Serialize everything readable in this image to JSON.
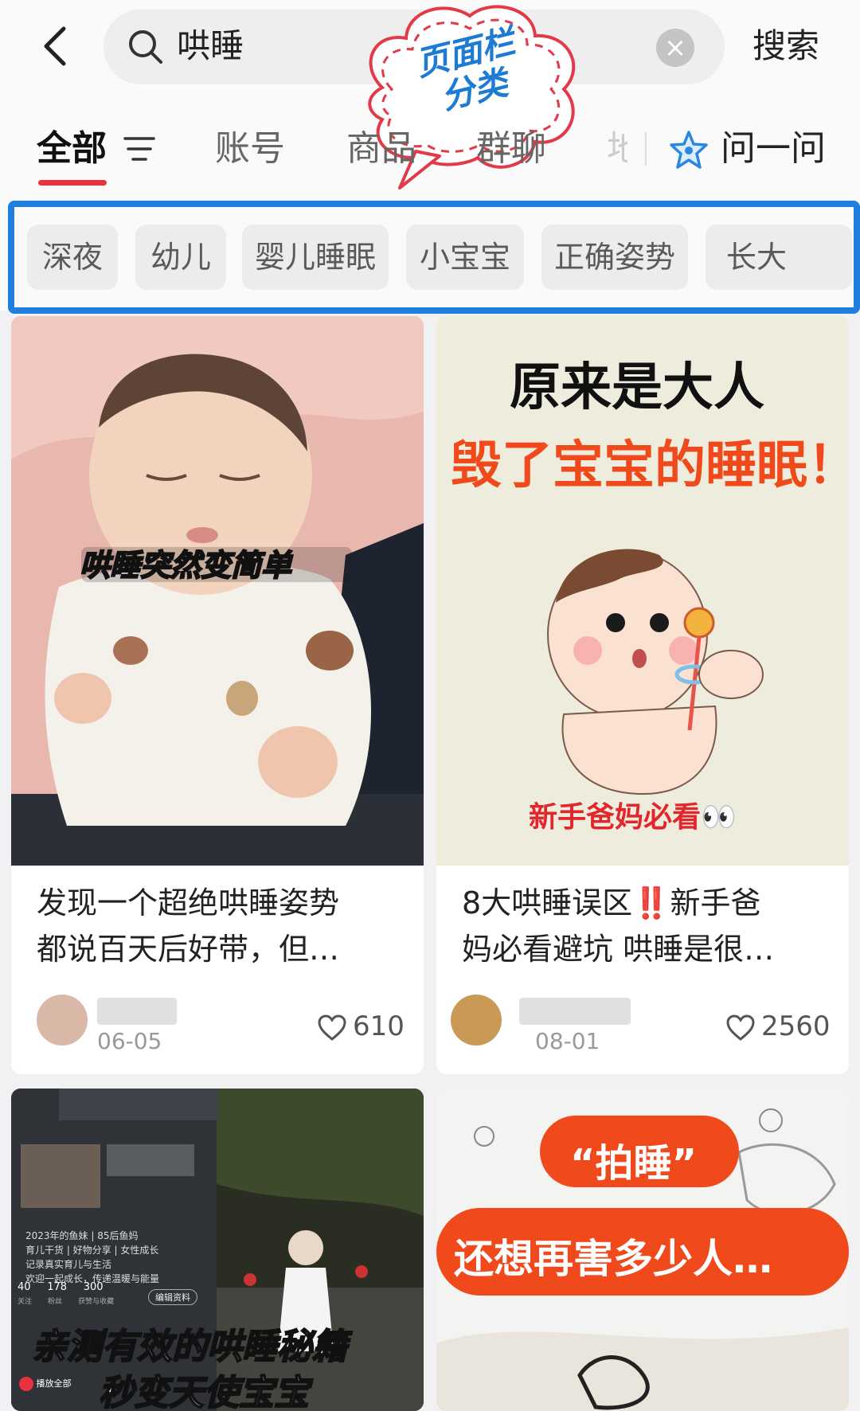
{
  "search": {
    "query": "哄睡",
    "clear": "×",
    "submit": "搜索"
  },
  "annotation": {
    "line1": "页面栏",
    "line2": "分类"
  },
  "tabs": [
    "全部",
    "账号",
    "商品",
    "群聊",
    "地"
  ],
  "ask": {
    "label": "问一问"
  },
  "chips": [
    "深夜",
    "幼儿",
    "婴儿睡眠",
    "小宝宝",
    "正确姿势",
    "长大"
  ],
  "cards": [
    {
      "overlay": [
        "哄睡突然变简单"
      ],
      "title_line1": "发现一个超绝哄睡姿势",
      "title_line2": "都说百天后好带，但…",
      "date": "06-05",
      "likes": "610"
    },
    {
      "overlay": [
        "原来是大人",
        "毁了宝宝的睡眠！",
        "新手爸妈必看👀"
      ],
      "title_line1": "8大哄睡误区‼️新手爸",
      "title_line2": "妈必看避坑 哄睡是很…",
      "date": "08-01",
      "likes": "2560"
    },
    {
      "overlay": [
        "亲测有效的哄睡秘籍",
        "秒变天使宝宝"
      ],
      "profile_stats": [
        "40",
        "178",
        "300"
      ],
      "profile_labels": [
        "关注",
        "粉丝",
        "获赞与收藏"
      ],
      "profile_bio": [
        "2023年的鱼妹 | 85后鱼妈",
        "育儿干货 | 好物分享 | 女性成长",
        "记录真实育儿与生活",
        "欢迎一起成长，传递温暖与能量"
      ],
      "edit_btn": "编辑资料",
      "play_all": "播放全部"
    },
    {
      "overlay": [
        "“拍睡”",
        "还想再害多少人…"
      ]
    }
  ],
  "colors": {
    "accent": "#e8323f",
    "highlight": "#1f7fdf",
    "warn": "#f04a1c"
  }
}
